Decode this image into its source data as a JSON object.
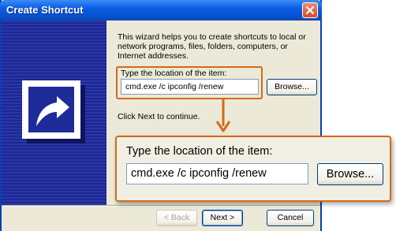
{
  "window": {
    "title": "Create Shortcut"
  },
  "icons": {
    "close": "close-icon",
    "shortcut": "shortcut-arrow-icon",
    "callout_arrow": "arrow-down-icon"
  },
  "colors": {
    "titlebar": "#0a5ee4",
    "banner": "#1f2b99",
    "highlight": "#d26b19",
    "dialog_bg": "#ece9d8"
  },
  "main": {
    "intro": "This wizard helps you to create shortcuts to local or network programs, files, folders, computers, or Internet addresses.",
    "location_label": "Type the location of the item:",
    "location_value": "cmd.exe /c ipconfig /renew",
    "browse_label": "Browse...",
    "next_instruction": "Click Next to continue."
  },
  "footer": {
    "back_label": "< Back",
    "next_label": "Next >",
    "cancel_label": "Cancel"
  },
  "callout": {
    "label": "Type the location of the item:",
    "value": "cmd.exe /c ipconfig /renew",
    "browse_label": "Browse..."
  }
}
